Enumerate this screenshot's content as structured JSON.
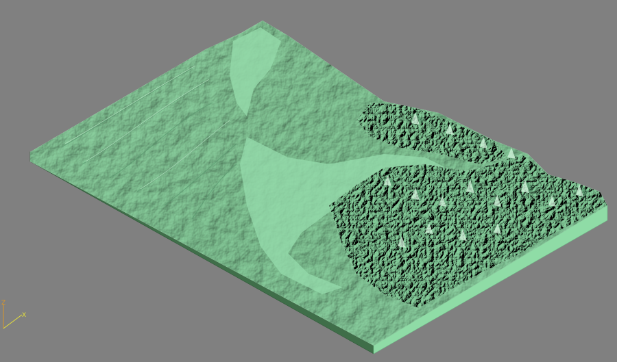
{
  "viewport": {
    "background": "#808080"
  },
  "model": {
    "top_color": "#8fd6a4",
    "ridge_color": "#b9ecc5",
    "shadow_color": "#4f8f66",
    "valley_color": "#86c99a",
    "front_side_color": "#3f6e49",
    "right_side_color": "#8fdca6"
  },
  "axes": {
    "z_label": "Z",
    "x_label": "X",
    "z_color": "#d9962a",
    "x_color": "#e7e23a"
  }
}
